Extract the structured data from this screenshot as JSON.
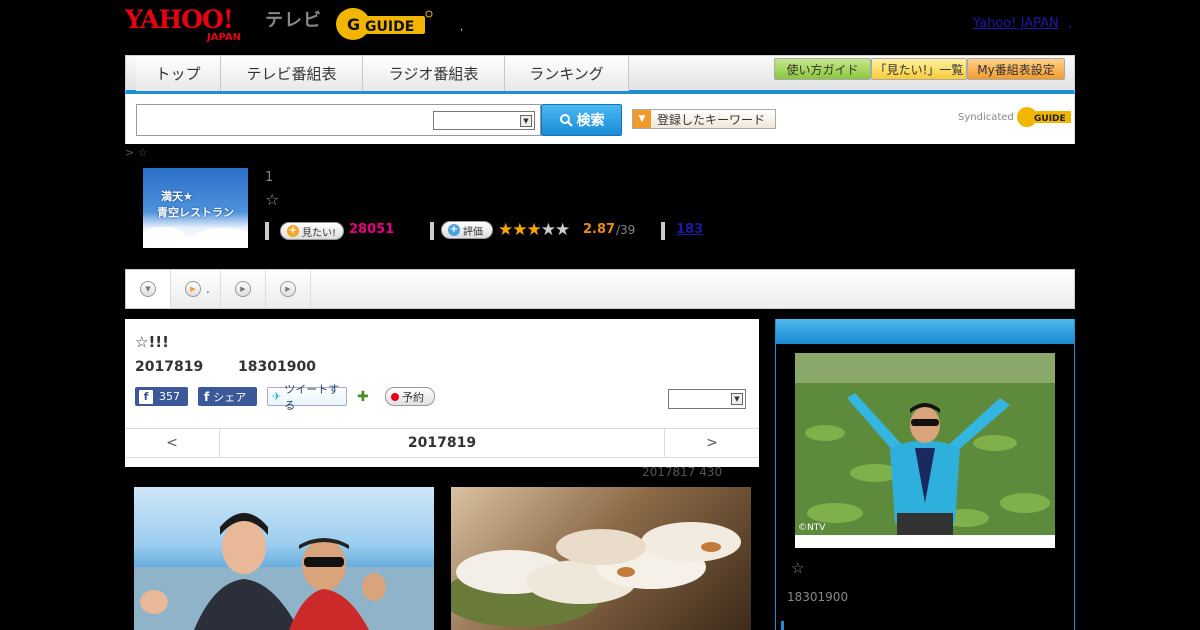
{
  "header": {
    "yahoo_logo": "YAHOO! JAPAN",
    "tv_label": "テレビ",
    "gguide_logo": "G GUIDE",
    "yahoo_japan_link": "Yahoo! JAPAN",
    "dot": ","
  },
  "nav": {
    "tabs": [
      "トップ",
      "テレビ番組表",
      "ラジオ番組表",
      "ランキング"
    ],
    "buttons": [
      "使い方ガイド",
      "「見たい!」一覧",
      "My番組表設定"
    ]
  },
  "search": {
    "button_label": "検索",
    "keyword_button": "登録したキーワード",
    "syndicated_label": "Syndicated"
  },
  "breadcrumb": "> ☆",
  "program": {
    "thumb_text": [
      "満天★",
      "青空レストラン"
    ],
    "number": "1",
    "star": "☆",
    "mitai_label": "見たい!",
    "mitai_count": "28051",
    "rating_label": "評価",
    "rating_value": "2.87",
    "rating_count": "/39",
    "rating_score": 2.87,
    "review_count": "183"
  },
  "tabbar": {
    "tab2_suffix": "."
  },
  "episode": {
    "title": "☆!!!",
    "date": "2017819",
    "time": "18301900",
    "like_count": "357",
    "share_label": "シェア",
    "tweet_label": "ツイートする",
    "reserve_label": "予約",
    "date_nav_prev": "<",
    "date_nav_current": "2017819",
    "date_nav_next": ">"
  },
  "update_info": "2017817  430",
  "sidebar": {
    "photo_credit": "©NTV",
    "star": "☆",
    "time": "18301900"
  },
  "colors": {
    "accent": "#1d8fd6",
    "mitai": "#e4007f",
    "rating": "#e88a1a",
    "link": "#1a1aa6"
  }
}
